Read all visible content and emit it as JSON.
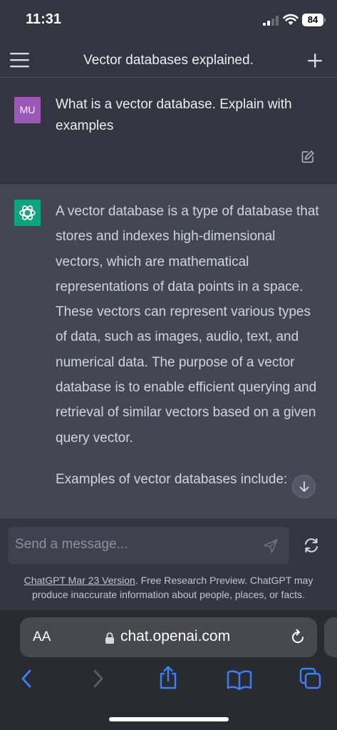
{
  "status_bar": {
    "time": "11:31",
    "battery": "84"
  },
  "nav": {
    "title": "Vector databases explained."
  },
  "user_message": {
    "avatar_initials": "MU",
    "avatar_color": "#9b59b6",
    "text": "What is a vector database. Explain with examples"
  },
  "assistant_message": {
    "avatar_color": "#10a37f",
    "paragraph_1": "A vector database is a type of database that stores and indexes high-dimensional vectors, which are mathematical representations of data points in a space. These vectors can represent various types of data, such as images, audio, text, and numerical data. The purpose of a vector database is to enable efficient querying and retrieval of similar vectors based on a given query vector.",
    "paragraph_2": "Examples of vector databases include:"
  },
  "composer": {
    "placeholder": "Send a message...",
    "disclaimer_link": "ChatGPT Mar 23 Version",
    "disclaimer_text": ". Free Research Preview. ChatGPT may produce inaccurate information about people, places, or facts."
  },
  "browser": {
    "aa_label": "AA",
    "url": "chat.openai.com",
    "accent_color": "#3a82f7"
  },
  "icons": [
    "signal-icon",
    "wifi-icon",
    "menu-icon",
    "plus-icon",
    "edit-icon",
    "openai-logo-icon",
    "arrow-down-icon",
    "send-icon",
    "regenerate-icon",
    "lock-icon",
    "reload-icon",
    "back-icon",
    "forward-icon",
    "share-icon",
    "bookmarks-icon",
    "tabs-icon"
  ]
}
